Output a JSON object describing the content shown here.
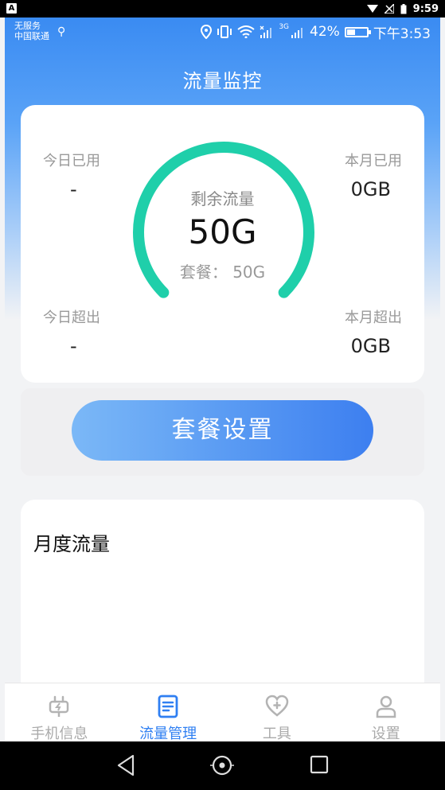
{
  "system_bar": {
    "badge": "A",
    "time": "9:59"
  },
  "status": {
    "carrier_line1": "无服务",
    "carrier_line2": "中国联通",
    "network_label": "3G",
    "battery_percent": "42%",
    "battery_level": 0.42,
    "time": "下午3:53"
  },
  "header": {
    "title": "流量监控"
  },
  "stats": {
    "today_used_label": "今日已用",
    "today_used_value": "-",
    "month_used_label": "本月已用",
    "month_used_value": "0GB",
    "today_over_label": "今日超出",
    "today_over_value": "-",
    "month_over_label": "本月超出",
    "month_over_value": "0GB"
  },
  "gauge": {
    "title": "剩余流量",
    "value": "50G",
    "plan": "套餐： 50G",
    "color": "#1fcfaa",
    "remaining_fraction": 1.0
  },
  "package_button": {
    "label": "套餐设置"
  },
  "monthly": {
    "title": "月度流量"
  },
  "bottom_nav": {
    "items": [
      {
        "label": "手机信息",
        "icon": "plug-icon",
        "active": false
      },
      {
        "label": "流量管理",
        "icon": "document-icon",
        "active": true
      },
      {
        "label": "工具",
        "icon": "heart-plus-icon",
        "active": false
      },
      {
        "label": "设置",
        "icon": "person-icon",
        "active": false
      }
    ]
  },
  "colors": {
    "accent": "#2f7ff2",
    "header_blue": "#3a8bf2",
    "gauge": "#1fcfaa"
  }
}
